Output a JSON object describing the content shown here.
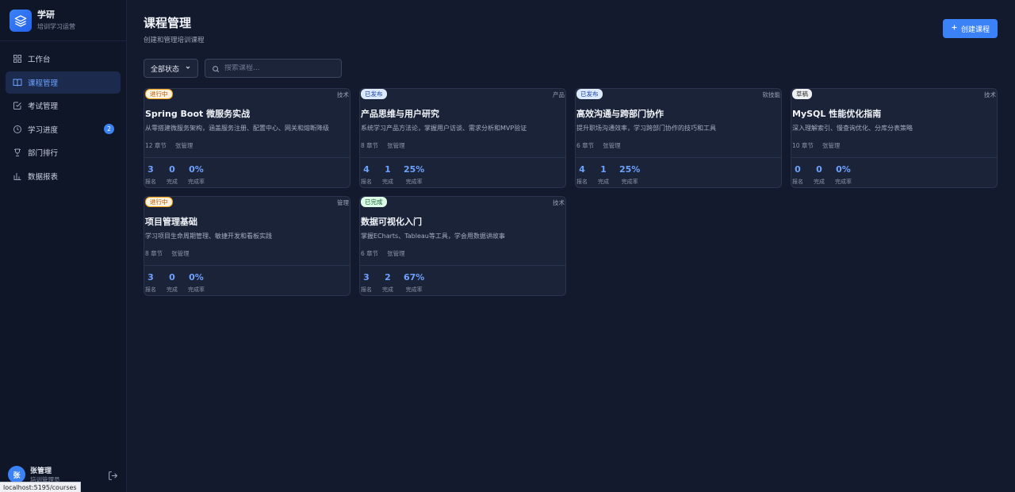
{
  "brand": {
    "title": "学研",
    "subtitle": "培训学习运营"
  },
  "nav": [
    {
      "label": "工作台",
      "icon": "dashboard-icon"
    },
    {
      "label": "课程管理",
      "icon": "book-icon",
      "active": true
    },
    {
      "label": "考试管理",
      "icon": "exam-icon"
    },
    {
      "label": "学习进度",
      "icon": "clock-icon",
      "badge": "2"
    },
    {
      "label": "部门排行",
      "icon": "trophy-icon"
    },
    {
      "label": "数据报表",
      "icon": "bar-chart-icon"
    }
  ],
  "user": {
    "avatar": "张",
    "name": "张管理",
    "role": "培训管理员"
  },
  "status_url": "localhost:5195/courses",
  "page": {
    "title": "课程管理",
    "subtitle": "创建和管理培训课程",
    "create_label": "创建课程"
  },
  "filters": {
    "status_value": "全部状态",
    "search_placeholder": "搜索课程..."
  },
  "stat_labels": {
    "enrolled": "报名",
    "completed": "完成",
    "rate": "完成率"
  },
  "courses": [
    {
      "status": "进行中",
      "status_type": "progress",
      "category": "技术",
      "title": "Spring Boot 微服务实战",
      "desc": "从零搭建微服务架构，涵盖服务注册、配置中心、网关和熔断降级",
      "chapters": "12 章节",
      "author": "张管理",
      "enrolled": "3",
      "completed": "0",
      "rate": "0%"
    },
    {
      "status": "已发布",
      "status_type": "published",
      "category": "产品",
      "title": "产品思维与用户研究",
      "desc": "系统学习产品方法论，掌握用户访谈、需求分析和MVP验证",
      "chapters": "8 章节",
      "author": "张管理",
      "enrolled": "4",
      "completed": "1",
      "rate": "25%"
    },
    {
      "status": "已发布",
      "status_type": "published",
      "category": "软技能",
      "title": "高效沟通与跨部门协作",
      "desc": "提升职场沟通效率，学习跨部门协作的技巧和工具",
      "chapters": "6 章节",
      "author": "张管理",
      "enrolled": "4",
      "completed": "1",
      "rate": "25%"
    },
    {
      "status": "草稿",
      "status_type": "draft",
      "category": "技术",
      "title": "MySQL 性能优化指南",
      "desc": "深入理解索引、慢查询优化、分库分表策略",
      "chapters": "10 章节",
      "author": "张管理",
      "enrolled": "0",
      "completed": "0",
      "rate": "0%"
    },
    {
      "status": "进行中",
      "status_type": "progress",
      "category": "管理",
      "title": "项目管理基础",
      "desc": "学习项目生命周期管理、敏捷开发和看板实践",
      "chapters": "8 章节",
      "author": "张管理",
      "enrolled": "3",
      "completed": "0",
      "rate": "0%"
    },
    {
      "status": "已完成",
      "status_type": "done",
      "category": "技术",
      "title": "数据可视化入门",
      "desc": "掌握ECharts、Tableau等工具，学会用数据讲故事",
      "chapters": "6 章节",
      "author": "张管理",
      "enrolled": "3",
      "completed": "2",
      "rate": "67%"
    }
  ],
  "colors": {
    "accent": "#3b82f6",
    "background": "#131a2e",
    "sidebar": "#0f1628"
  }
}
